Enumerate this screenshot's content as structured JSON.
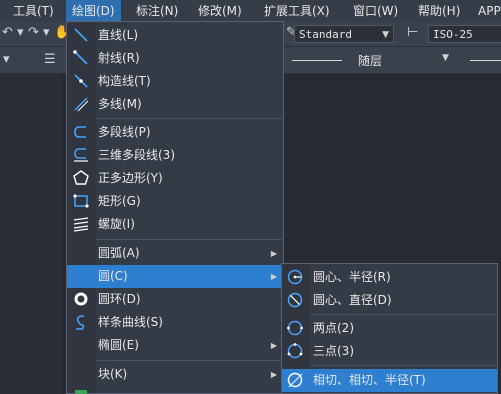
{
  "menubar": {
    "items": [
      "工具(T)",
      "绘图(D)",
      "标注(N)",
      "修改(M)",
      "扩展工具(X)",
      "窗口(W)",
      "帮助(H)",
      "APP"
    ]
  },
  "toolbar": {
    "text_style": "Standard",
    "dim_style": "ISO-25",
    "layer_value": "随层"
  },
  "menu": {
    "items": [
      {
        "label": "直线(L)",
        "icon": "line-icon"
      },
      {
        "label": "射线(R)",
        "icon": "ray-icon"
      },
      {
        "label": "构造线(T)",
        "icon": "construction-line-icon"
      },
      {
        "label": "多线(M)",
        "icon": "multiline-icon"
      },
      {
        "label": "多段线(P)",
        "icon": "polyline-icon"
      },
      {
        "label": "三维多段线(3)",
        "icon": "3d-polyline-icon"
      },
      {
        "label": "正多边形(Y)",
        "icon": "polygon-icon"
      },
      {
        "label": "矩形(G)",
        "icon": "rectangle-icon"
      },
      {
        "label": "螺旋(I)",
        "icon": "helix-icon"
      },
      {
        "label": "圆弧(A)",
        "icon": ""
      },
      {
        "label": "圆(C)",
        "icon": ""
      },
      {
        "label": "圆环(D)",
        "icon": "donut-icon"
      },
      {
        "label": "样条曲线(S)",
        "icon": "spline-icon"
      },
      {
        "label": "椭圆(E)",
        "icon": ""
      },
      {
        "label": "块(K)",
        "icon": ""
      }
    ]
  },
  "submenu": {
    "items": [
      {
        "label": "圆心、半径(R)",
        "icon": "circle-center-radius-icon"
      },
      {
        "label": "圆心、直径(D)",
        "icon": "circle-center-diameter-icon"
      },
      {
        "label": "两点(2)",
        "icon": "circle-2point-icon"
      },
      {
        "label": "三点(3)",
        "icon": "circle-3point-icon"
      },
      {
        "label": "相切、相切、半径(T)",
        "icon": "circle-ttr-icon"
      }
    ]
  },
  "colors": {
    "highlight": "#2f7fd0",
    "menu_bg": "#353b46",
    "active_menu": "#2f6fb0"
  }
}
